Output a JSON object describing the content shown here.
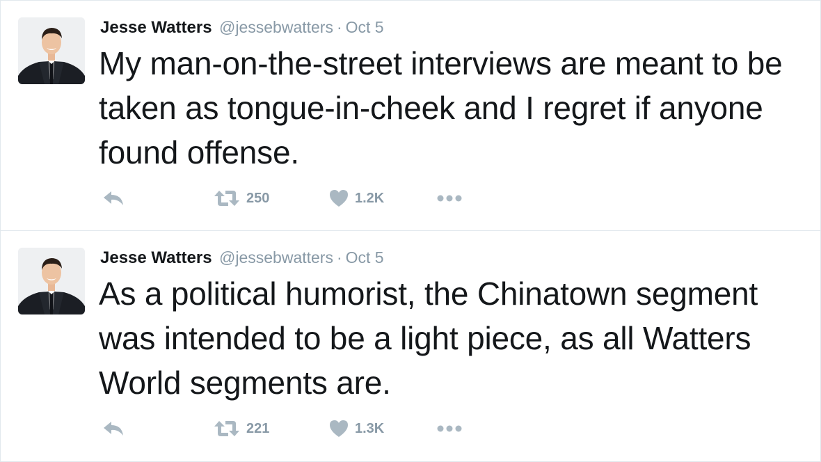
{
  "tweets": [
    {
      "author_name": "Jesse Watters",
      "handle": "@jessebwatters",
      "separator": "·",
      "date": "Oct 5",
      "text": "My man-on-the-street interviews are meant to be taken as tongue-in-cheek and I regret if anyone found offense.",
      "retweets": "250",
      "likes": "1.2K",
      "avatar_icon": "profile-photo",
      "icons": [
        "reply-icon",
        "retweet-icon",
        "heart-icon",
        "more-icon"
      ]
    },
    {
      "author_name": "Jesse Watters",
      "handle": "@jessebwatters",
      "separator": "·",
      "date": "Oct 5",
      "text": "As a political humorist, the Chinatown segment was intended to be a light piece, as all Watters World segments are.",
      "retweets": "221",
      "likes": "1.3K",
      "avatar_icon": "profile-photo",
      "icons": [
        "reply-icon",
        "retweet-icon",
        "heart-icon",
        "more-icon"
      ]
    }
  ],
  "colors": {
    "text": "#14171a",
    "muted": "#8899a6",
    "icon": "#aab8c2",
    "border": "#e1e8ed"
  }
}
